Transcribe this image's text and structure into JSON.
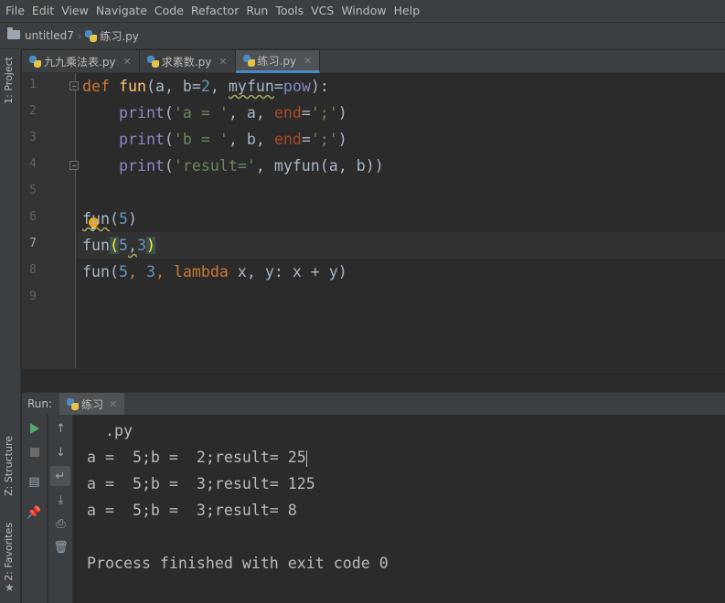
{
  "menu": [
    "File",
    "Edit",
    "View",
    "Navigate",
    "Code",
    "Refactor",
    "Run",
    "Tools",
    "VCS",
    "Window",
    "Help"
  ],
  "breadcrumb": {
    "project": "untitled7",
    "file": "练习.py"
  },
  "left_tools": {
    "project": "1: Project",
    "structure": "Z: Structure",
    "favorites": "2: Favorites"
  },
  "tabs": [
    {
      "label": "九九乘法表.py",
      "active": false
    },
    {
      "label": "求素数.py",
      "active": false
    },
    {
      "label": "练习.py",
      "active": true
    }
  ],
  "line_numbers": [
    "1",
    "2",
    "3",
    "4",
    "5",
    "6",
    "7",
    "8",
    "9"
  ],
  "current_line": 7,
  "code_tokens": {
    "l1": [
      "def",
      "fun",
      "(a, b=",
      "2",
      ", ",
      "myfun",
      "=",
      "pow",
      "):"
    ],
    "l2": [
      "print",
      "(",
      "'a = '",
      ", a, ",
      "end",
      "=",
      "';'",
      ")"
    ],
    "l3": [
      "print",
      "(",
      "'b = '",
      ", b, ",
      "end",
      "=",
      "';'",
      ")"
    ],
    "l4": [
      "print",
      "(",
      "'result='",
      ", myfun(a, b))"
    ],
    "l6": [
      "fun",
      "(",
      "5",
      ")"
    ],
    "l7": [
      "fun",
      "(",
      "5",
      ",",
      "3",
      ")"
    ],
    "l8": [
      "fun(",
      "5",
      ", ",
      "3",
      ", ",
      "lambda",
      " x, y: x + y)"
    ]
  },
  "run": {
    "label": "Run:",
    "tab": "练习",
    "output": [
      "  .py",
      "a =  5;b =  2;result= 25",
      "a =  5;b =  3;result= 125",
      "a =  5;b =  3;result= 8",
      "",
      "Process finished with exit code 0"
    ]
  },
  "icons": [
    "folder-icon",
    "python-file-icon",
    "close-icon",
    "run-icon",
    "stop-icon",
    "layout-icon",
    "pin-icon",
    "up-arrow-icon",
    "down-arrow-icon",
    "soft-wrap-icon",
    "scroll-to-end-icon",
    "print-icon",
    "trash-icon",
    "intention-bulb-icon",
    "star-icon"
  ],
  "colors": {
    "keyword": "#cc7832",
    "function": "#ffc66d",
    "number": "#6897bb",
    "string": "#6a8759",
    "param": "#aa4926",
    "builtin": "#8888c6",
    "run_green": "#59a869"
  }
}
